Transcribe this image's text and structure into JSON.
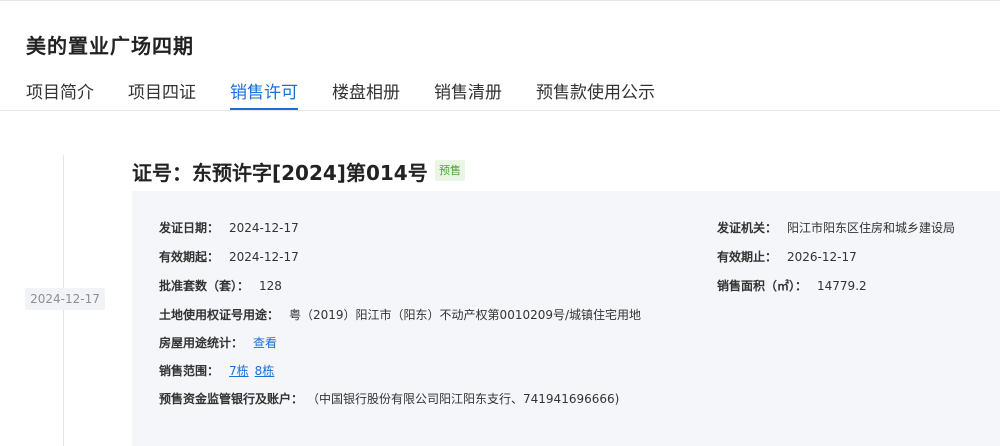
{
  "project": {
    "title": "美的置业广场四期"
  },
  "tabs": [
    {
      "label": "项目简介"
    },
    {
      "label": "项目四证"
    },
    {
      "label": "销售许可",
      "active": true
    },
    {
      "label": "楼盘相册"
    },
    {
      "label": "销售清册"
    },
    {
      "label": "预售款使用公示"
    }
  ],
  "timeline": {
    "date": "2024-12-17"
  },
  "certificate": {
    "title": "证号：东预许字[2024]第014号",
    "badge": "预售",
    "issue_date_label": "发证日期：",
    "issue_date": "2024-12-17",
    "valid_from_label": "有效期起：",
    "valid_from": "2024-12-17",
    "approved_units_label": "批准套数（套）：",
    "approved_units": "128",
    "land_use_label": "土地使用权证号用途：",
    "land_use": "粤（2019）阳江市（阳东）不动产权第0010209号/城镇住宅用地",
    "house_use_stats_label": "房屋用途统计：",
    "house_use_stats_link": "查看",
    "sale_range_label": "销售范围：",
    "sale_range": [
      "7栋",
      "8栋"
    ],
    "escrow_label": "预售资金监管银行及账户：",
    "escrow": "（中国银行股份有限公司阳江阳东支行、741941696666)",
    "issuer_label": "发证机关：",
    "issuer": "阳江市阳东区住房和城乡建设局",
    "valid_to_label": "有效期止：",
    "valid_to": "2026-12-17",
    "sale_area_label": "销售面积（㎡）：",
    "sale_area": "14779.2"
  }
}
